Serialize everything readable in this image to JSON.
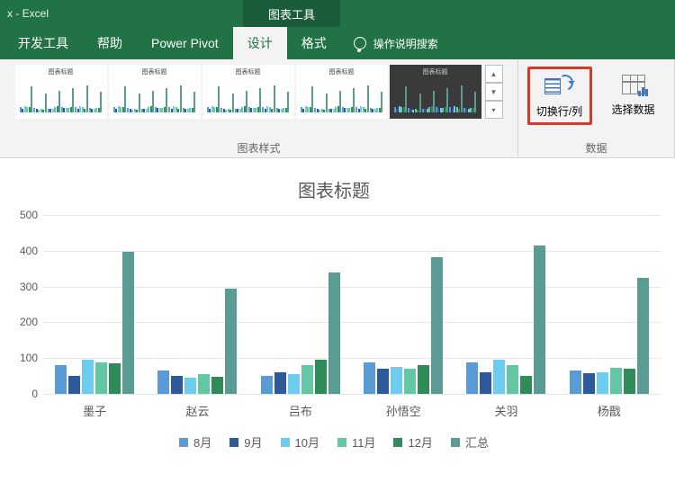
{
  "window": {
    "title_suffix": "x - Excel",
    "context_tab": "图表工具"
  },
  "tabs": {
    "dev": "开发工具",
    "help": "帮助",
    "pivot": "Power Pivot",
    "design": "设计",
    "format": "格式",
    "tell": "操作说明搜索"
  },
  "ribbon": {
    "styles_group": "图表样式",
    "data_group": "数据",
    "switch_rc": "切换行/列",
    "select_data": "选择数据",
    "thumb_caption": "图表标题"
  },
  "chart_data": {
    "type": "bar",
    "title": "图表标题",
    "categories": [
      "墨子",
      "赵云",
      "吕布",
      "孙悟空",
      "关羽",
      "杨戬"
    ],
    "series": [
      {
        "name": "8月",
        "color": "#5b9bd5",
        "values": [
          80,
          65,
          50,
          88,
          88,
          65
        ]
      },
      {
        "name": "9月",
        "color": "#2e5a9c",
        "values": [
          50,
          50,
          60,
          70,
          60,
          58
        ]
      },
      {
        "name": "10月",
        "color": "#6ecdee",
        "values": [
          95,
          45,
          55,
          75,
          95,
          60
        ]
      },
      {
        "name": "11月",
        "color": "#63c7a3",
        "values": [
          88,
          55,
          80,
          70,
          80,
          72
        ]
      },
      {
        "name": "12月",
        "color": "#2f8b57",
        "values": [
          85,
          48,
          95,
          80,
          50,
          70
        ]
      },
      {
        "name": "汇总",
        "color": "#5a9b94",
        "values": [
          398,
          295,
          340,
          382,
          415,
          325
        ]
      }
    ],
    "ylim": [
      0,
      500
    ],
    "yticks": [
      0,
      100,
      200,
      300,
      400,
      500
    ]
  }
}
